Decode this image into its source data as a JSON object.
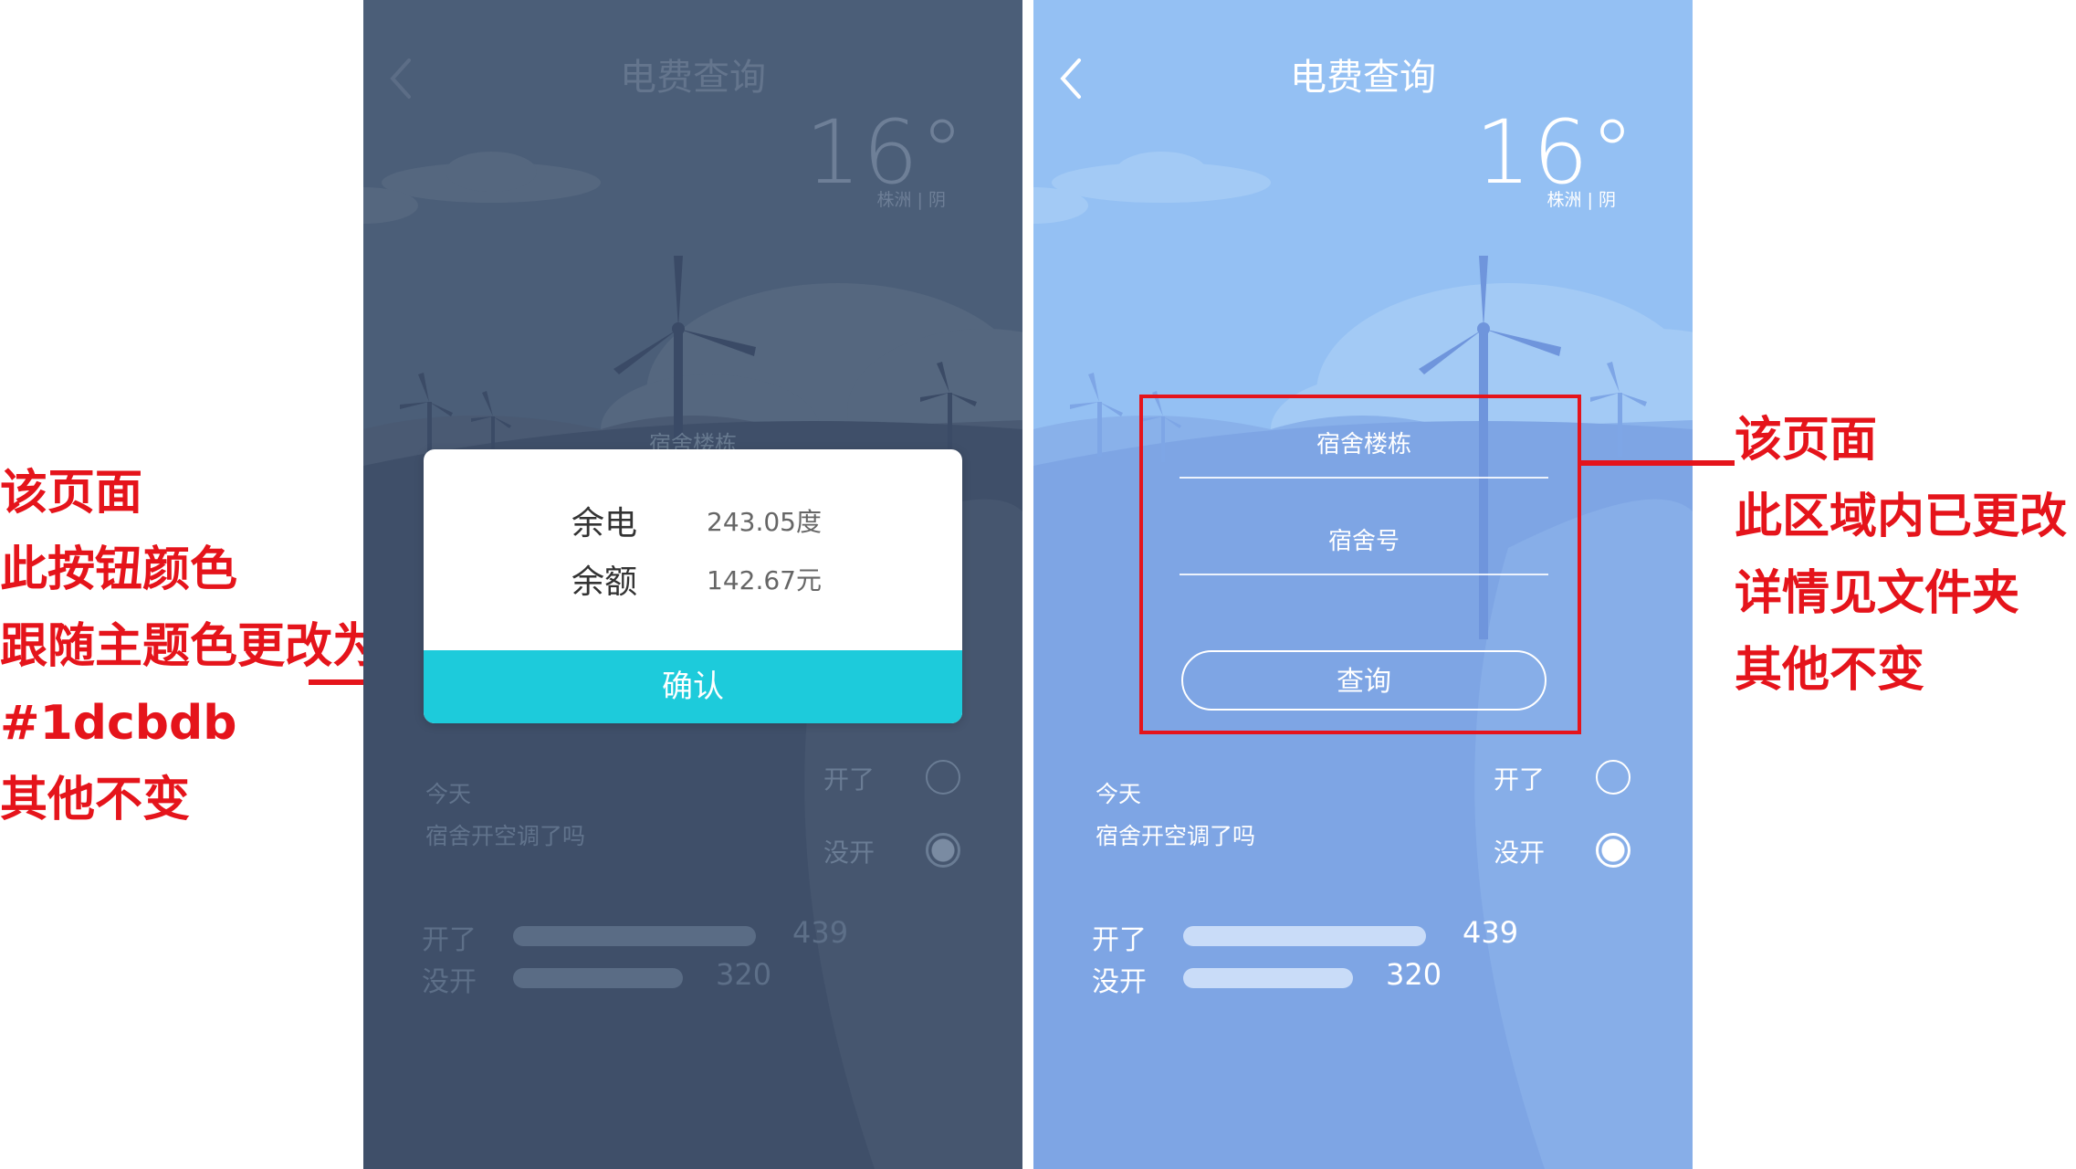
{
  "left_annotation": {
    "lines": [
      "该页面",
      "此按钮颜色",
      "跟随主题色更改为",
      "#1dcbdb",
      "其他不变"
    ]
  },
  "right_annotation": {
    "lines": [
      "该页面",
      "此区域内已更改",
      "详情见文件夹",
      "其他不变"
    ]
  },
  "colors": {
    "annotation": "#e5141b",
    "theme_button": "#1dcbdb",
    "left_bg": "#44536e",
    "right_bg": "#8fb8ef"
  },
  "left_phone": {
    "title": "电费查询",
    "back_icon": "chevron-left-icon",
    "temperature": "16°",
    "location_weather": "株洲 | 阴",
    "faded_field_label": "宿舍楼栋",
    "dialog": {
      "label_power": "余电",
      "value_power": "243.05度",
      "label_balance": "余额",
      "value_balance": "142.67元",
      "confirm": "确认"
    },
    "poll": {
      "today": "今天",
      "question": "宿舍开空调了吗",
      "opt_on": "开了",
      "opt_off": "没开"
    },
    "stats": {
      "on_label": "开了",
      "on_value": "439",
      "off_label": "没开",
      "off_value": "320"
    }
  },
  "right_phone": {
    "title": "电费查询",
    "back_icon": "chevron-left-icon",
    "temperature": "16°",
    "location_weather": "株洲 | 阴",
    "form": {
      "building_placeholder": "宿舍楼栋",
      "room_placeholder": "宿舍号",
      "query_button": "查询"
    },
    "poll": {
      "today": "今天",
      "question": "宿舍开空调了吗",
      "opt_on": "开了",
      "opt_off": "没开"
    },
    "stats": {
      "on_label": "开了",
      "on_value": "439",
      "off_label": "没开",
      "off_value": "320"
    }
  }
}
